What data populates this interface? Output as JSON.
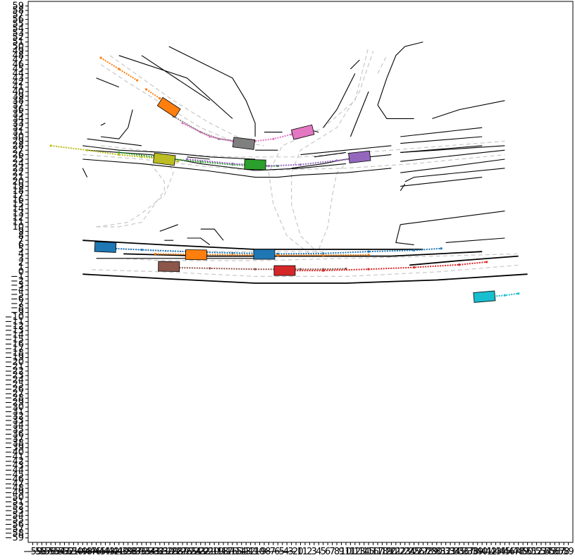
{
  "chart_data": {
    "type": "scatter",
    "title": "",
    "xlabel": "",
    "ylabel": "",
    "xlim": [
      -60,
      60
    ],
    "ylim": [
      -60,
      60
    ],
    "grid": false,
    "x_ticks": [
      -59,
      -58,
      -57,
      -56,
      -55,
      -54,
      -53,
      -52,
      -51,
      -50,
      -49,
      -48,
      -47,
      -46,
      -45,
      -44,
      -43,
      -42,
      -41,
      -40,
      -39,
      -38,
      -37,
      -36,
      -35,
      -34,
      -33,
      -32,
      -31,
      -30,
      -29,
      -28,
      -27,
      -26,
      -25,
      -24,
      -23,
      -22,
      -21,
      -20,
      -19,
      -18,
      -17,
      -16,
      -15,
      -14,
      -13,
      -12,
      -11,
      -10,
      -9,
      -8,
      -7,
      -6,
      -5,
      -4,
      -3,
      -2,
      -1,
      0,
      1,
      2,
      3,
      4,
      5,
      6,
      7,
      8,
      9,
      10,
      11,
      12,
      13,
      14,
      15,
      16,
      17,
      18,
      19,
      20,
      21,
      22,
      23,
      24,
      25,
      26,
      27,
      28,
      29,
      30,
      31,
      32,
      33,
      34,
      35,
      36,
      37,
      38,
      39,
      40,
      41,
      42,
      43,
      44,
      45,
      46,
      47,
      48,
      49,
      50,
      51,
      52,
      53,
      54,
      55,
      56,
      57,
      58,
      59
    ],
    "y_ticks": [
      -59,
      -58,
      -57,
      -56,
      -55,
      -54,
      -53,
      -52,
      -51,
      -50,
      -49,
      -48,
      -47,
      -46,
      -45,
      -44,
      -43,
      -42,
      -41,
      -40,
      -39,
      -38,
      -37,
      -36,
      -35,
      -34,
      -33,
      -32,
      -31,
      -30,
      -29,
      -28,
      -27,
      -26,
      -25,
      -24,
      -23,
      -22,
      -21,
      -20,
      -19,
      -18,
      -17,
      -16,
      -15,
      -14,
      -13,
      -12,
      -11,
      -10,
      -9,
      -8,
      -7,
      -6,
      -5,
      -4,
      -3,
      -2,
      -1,
      0,
      1,
      2,
      3,
      4,
      5,
      6,
      7,
      8,
      9,
      10,
      11,
      12,
      13,
      14,
      15,
      16,
      17,
      18,
      19,
      20,
      21,
      22,
      23,
      24,
      25,
      26,
      27,
      28,
      29,
      30,
      31,
      32,
      33,
      34,
      35,
      36,
      37,
      38,
      39,
      40,
      41,
      42,
      43,
      44,
      45,
      46,
      47,
      48,
      49,
      50,
      51,
      52,
      53,
      54,
      55,
      56,
      57,
      58,
      59
    ],
    "road_boundaries": [
      [
        [
          -48,
          -0.5
        ],
        [
          -30,
          -1.5
        ],
        [
          -10,
          -2.5
        ],
        [
          10,
          -2.5
        ],
        [
          30,
          -1.8
        ],
        [
          50,
          -0.5
        ]
      ],
      [
        [
          -48,
          7
        ],
        [
          -30,
          6
        ],
        [
          -10,
          5
        ],
        [
          10,
          5
        ],
        [
          27,
          5
        ]
      ],
      [
        [
          -39,
          4
        ],
        [
          -20,
          3.5
        ],
        [
          0,
          3.5
        ],
        [
          20,
          3.5
        ],
        [
          40,
          4.5
        ]
      ],
      [
        [
          24,
          1.5
        ],
        [
          35,
          2.5
        ],
        [
          48,
          3.5
        ]
      ],
      [
        [
          -45,
          3
        ],
        [
          -30,
          3
        ],
        [
          -10,
          3
        ]
      ],
      [
        [
          32,
          6.5
        ],
        [
          45,
          7.5
        ]
      ],
      [
        [
          22,
          10.5
        ],
        [
          45,
          13.5
        ]
      ],
      [
        [
          22,
          10.5
        ],
        [
          21,
          6.5
        ],
        [
          25,
          6
        ]
      ],
      [
        [
          -30,
          7
        ],
        [
          -28,
          7
        ]
      ],
      [
        [
          -25,
          7.5
        ],
        [
          -22,
          7.5
        ],
        [
          -20,
          6
        ]
      ],
      [
        [
          -22,
          9.5
        ],
        [
          -19,
          9.5
        ],
        [
          -17,
          7
        ]
      ],
      [
        [
          -31,
          9
        ],
        [
          -27,
          10.5
        ]
      ],
      [
        [
          -48,
          23
        ],
        [
          -47,
          21
        ]
      ],
      [
        [
          -48,
          25
        ],
        [
          -35,
          24
        ],
        [
          -21,
          22.5
        ],
        [
          -10,
          21
        ],
        [
          -5,
          21
        ],
        [
          0,
          21.5
        ],
        [
          10,
          22
        ],
        [
          20,
          23
        ]
      ],
      [
        [
          -47,
          27
        ],
        [
          -33,
          26
        ],
        [
          -22,
          24
        ],
        [
          -10,
          22.5
        ],
        [
          0,
          23
        ],
        [
          10,
          24
        ]
      ],
      [
        [
          -48,
          28
        ],
        [
          -40,
          27
        ],
        [
          -30,
          26.5
        ],
        [
          -20,
          25.5
        ],
        [
          -10,
          25
        ]
      ],
      [
        [
          -47,
          29.5
        ],
        [
          -35,
          28
        ]
      ],
      [
        [
          -2,
          23
        ],
        [
          5,
          24
        ],
        [
          10,
          25
        ],
        [
          15,
          25.5
        ],
        [
          20,
          26
        ]
      ],
      [
        [
          -25,
          25.5
        ],
        [
          -20,
          25
        ]
      ],
      [
        [
          0,
          26
        ],
        [
          10,
          27
        ],
        [
          20,
          28
        ]
      ],
      [
        [
          -10,
          27
        ],
        [
          -5,
          27
        ]
      ],
      [
        [
          3,
          25.5
        ],
        [
          10,
          26.5
        ]
      ],
      [
        [
          22,
          26.5
        ],
        [
          40,
          28
        ]
      ],
      [
        [
          22,
          28.5
        ],
        [
          40,
          30
        ]
      ],
      [
        [
          22,
          30
        ],
        [
          40,
          32
        ]
      ],
      [
        [
          22,
          26.5
        ],
        [
          30,
          27
        ],
        [
          45,
          28
        ]
      ],
      [
        [
          22,
          24.5
        ],
        [
          45,
          27
        ]
      ],
      [
        [
          22,
          22
        ],
        [
          30,
          23
        ],
        [
          45,
          25
        ]
      ],
      [
        [
          23,
          20
        ],
        [
          25,
          21
        ],
        [
          45,
          23
        ]
      ],
      [
        [
          22,
          18
        ],
        [
          23,
          19.5
        ]
      ],
      [
        [
          22,
          19
        ],
        [
          40,
          21
        ]
      ],
      [
        [
          -44,
          30
        ],
        [
          -40,
          29.5
        ],
        [
          -38,
          32
        ]
      ],
      [
        [
          -4,
          31
        ],
        [
          -8,
          31
        ]
      ],
      [
        [
          -2,
          31
        ],
        [
          2,
          31.5
        ],
        [
          4,
          31
        ]
      ],
      [
        [
          -45,
          43
        ],
        [
          -40,
          41
        ]
      ],
      [
        [
          -40,
          48
        ],
        [
          -25,
          43
        ],
        [
          -15,
          34
        ]
      ],
      [
        [
          -35,
          48
        ],
        [
          -20,
          38
        ]
      ],
      [
        [
          -29,
          50
        ],
        [
          -15,
          43
        ],
        [
          -12,
          38
        ],
        [
          -10,
          33
        ],
        [
          -10,
          30
        ]
      ],
      [
        [
          5,
          32
        ],
        [
          8,
          36
        ],
        [
          12,
          44
        ]
      ],
      [
        [
          11,
          45
        ],
        [
          13,
          47
        ]
      ],
      [
        [
          11,
          30
        ],
        [
          15,
          40
        ]
      ],
      [
        [
          17,
          37
        ],
        [
          19,
          34
        ],
        [
          25,
          34
        ]
      ],
      [
        [
          17,
          37
        ],
        [
          19,
          43
        ],
        [
          21,
          48
        ],
        [
          23,
          50
        ],
        [
          27,
          51
        ]
      ],
      [
        [
          29,
          34
        ],
        [
          35,
          36
        ],
        [
          45,
          38
        ]
      ],
      [
        [
          -43,
          33
        ],
        [
          -44,
          32.5
        ]
      ],
      [
        [
          -38,
          32
        ],
        [
          -37,
          36
        ]
      ]
    ],
    "lane_centerlines": [
      [
        [
          -45,
          10
        ],
        [
          -40,
          10
        ],
        [
          -35,
          11
        ],
        [
          -30,
          18
        ],
        [
          -30,
          20
        ],
        [
          -33,
          24
        ]
      ],
      [
        [
          -45,
          10
        ],
        [
          -38,
          11
        ],
        [
          -35,
          13
        ],
        [
          -30,
          17
        ],
        [
          -28,
          22
        ],
        [
          -30,
          26
        ]
      ],
      [
        [
          -44,
          5.5
        ],
        [
          -30,
          4.5
        ],
        [
          -10,
          4.5
        ],
        [
          5,
          4.5
        ]
      ],
      [
        [
          -40,
          3
        ],
        [
          -30,
          2.5
        ],
        [
          -10,
          2.5
        ],
        [
          10,
          3
        ],
        [
          30,
          3.5
        ],
        [
          48,
          4
        ]
      ],
      [
        [
          -46,
          0.5
        ],
        [
          -30,
          0
        ],
        [
          -10,
          -1
        ],
        [
          10,
          -1
        ],
        [
          30,
          0
        ],
        [
          48,
          1.5
        ]
      ],
      [
        [
          -44,
          28
        ],
        [
          -35,
          27
        ],
        [
          -25,
          26
        ],
        [
          -15,
          25.5
        ],
        [
          0,
          25.5
        ],
        [
          20,
          27
        ],
        [
          45,
          29
        ]
      ],
      [
        [
          -48,
          26
        ],
        [
          -35,
          25
        ],
        [
          -22,
          23.5
        ],
        [
          -10,
          22.5
        ],
        [
          10,
          23
        ],
        [
          25,
          24
        ],
        [
          45,
          26
        ]
      ],
      [
        [
          -44,
          46
        ],
        [
          -38,
          42
        ],
        [
          -30,
          37
        ],
        [
          -22,
          32
        ],
        [
          -15,
          29
        ],
        [
          -8,
          28
        ]
      ],
      [
        [
          -42,
          48
        ],
        [
          -35,
          43
        ],
        [
          -28,
          38
        ],
        [
          -20,
          33
        ],
        [
          -12,
          29
        ]
      ],
      [
        [
          2,
          4
        ],
        [
          -3,
          8
        ],
        [
          -6,
          15
        ],
        [
          -7,
          22
        ],
        [
          -4,
          28
        ],
        [
          5,
          32
        ],
        [
          12,
          38
        ],
        [
          15,
          50
        ]
      ],
      [
        [
          4,
          4
        ],
        [
          0,
          8
        ],
        [
          -2,
          15
        ],
        [
          -2,
          22
        ],
        [
          0,
          27
        ],
        [
          8,
          32
        ],
        [
          13,
          40
        ],
        [
          16,
          49
        ]
      ],
      [
        [
          4,
          5
        ],
        [
          6,
          10
        ],
        [
          7,
          17
        ],
        [
          8,
          22
        ],
        [
          10,
          24
        ]
      ],
      [
        [
          17,
          44
        ],
        [
          19,
          48
        ]
      ]
    ],
    "series": [
      {
        "color": "#1f77b4",
        "points": [
          [
            -44,
            5.3
          ],
          [
            -35,
            4.9
          ],
          [
            -25,
            4.5
          ],
          [
            -15,
            4.2
          ],
          [
            -5,
            4
          ],
          [
            5,
            4.1
          ],
          [
            15,
            4.5
          ],
          [
            25,
            4.8
          ],
          [
            31,
            5.2
          ]
        ],
        "box": [
          -43,
          5.5,
          27
        ]
      },
      {
        "color": "#ff7f0e",
        "points": [
          [
            -32,
            4
          ],
          [
            -25,
            3.9
          ],
          [
            -15,
            3.8
          ],
          [
            -5,
            3.7
          ],
          [
            5,
            3.7
          ],
          [
            15,
            3.8
          ]
        ],
        "box": [
          -23,
          3.8,
          28
        ]
      },
      {
        "color": "#ff7f0e",
        "points": [
          [
            -44,
            47.5
          ],
          [
            -40,
            45
          ],
          [
            -36,
            42.5
          ]
        ],
        "box": null
      },
      {
        "color": "#ff7f0e",
        "points": [
          [
            -34,
            40.5
          ],
          [
            -31,
            38.5
          ]
        ],
        "box": [
          -29,
          36.5,
          28
        ]
      },
      {
        "color": "#1f77b4",
        "points": [],
        "box": [
          -8,
          3.9,
          20
        ]
      },
      {
        "color": "#8c564b",
        "points": [
          [
            -30,
            1
          ],
          [
            -20,
            0.8
          ],
          [
            -10,
            0.6
          ],
          [
            0,
            0.6
          ],
          [
            5,
            0.6
          ],
          [
            10,
            0.7
          ]
        ],
        "box": [
          -29,
          1.2,
          19
        ]
      },
      {
        "color": "#d62728",
        "points": [
          [
            -3,
            0.3
          ],
          [
            5,
            0.3
          ],
          [
            15,
            0.6
          ],
          [
            25,
            1
          ],
          [
            35,
            1.6
          ],
          [
            41,
            2.2
          ]
        ],
        "box": [
          -3.5,
          0.3,
          17
        ]
      },
      {
        "color": "#17becf",
        "points": [
          [
            41.5,
            -5.5
          ],
          [
            45,
            -5.2
          ],
          [
            48,
            -4.8
          ]
        ],
        "box": [
          40.5,
          -5.5,
          20
        ]
      },
      {
        "color": "#bcbd22",
        "points": [
          [
            -55,
            28
          ],
          [
            -47,
            27
          ],
          [
            -40,
            26
          ],
          [
            -35,
            25.5
          ],
          [
            -30,
            25
          ],
          [
            -27,
            24.5
          ]
        ],
        "box": [
          -30,
          25,
          20
        ]
      },
      {
        "color": "#2ca02c",
        "points": [
          [
            -40,
            26.5
          ],
          [
            -30,
            25.2
          ],
          [
            -22,
            24.4
          ],
          [
            -15,
            23.8
          ],
          [
            -10,
            23.5
          ],
          [
            -5,
            23.5
          ]
        ],
        "box": [
          -10,
          23.8,
          16
        ]
      },
      {
        "color": "#9467bd",
        "points": [
          [
            -25,
            25
          ],
          [
            -15,
            24
          ],
          [
            -7,
            23.5
          ],
          [
            0,
            23.8
          ],
          [
            8,
            24.7
          ],
          [
            15,
            25.5
          ]
        ],
        "box": [
          13,
          25.5,
          19
        ]
      },
      {
        "color": "#7f7f7f",
        "points": [
          [
            -28,
            34.5
          ],
          [
            -22,
            31
          ],
          [
            -18,
            29.5
          ],
          [
            -14,
            29
          ]
        ],
        "box": [
          -12.5,
          28.5,
          17
        ]
      },
      {
        "color": "#e377c2",
        "points": [
          [
            -26,
            33
          ],
          [
            -20,
            30
          ],
          [
            -15,
            29
          ],
          [
            -10,
            29
          ],
          [
            -6,
            29.5
          ],
          [
            -2,
            30.5
          ]
        ],
        "box": [
          0.5,
          31,
          22
        ]
      }
    ]
  }
}
